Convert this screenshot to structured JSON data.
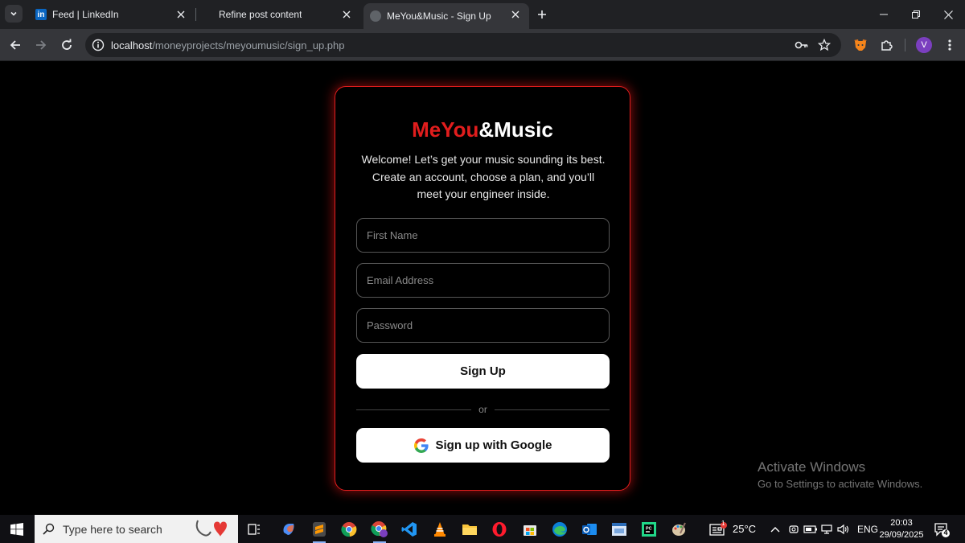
{
  "browser": {
    "tabs": [
      {
        "title": "Feed | LinkedIn",
        "favicon": "linkedin-icon",
        "active": false
      },
      {
        "title": "Refine post content",
        "favicon": "none",
        "active": false
      },
      {
        "title": "MeYou&Music - Sign Up",
        "favicon": "globe-icon",
        "active": true
      }
    ],
    "url_host": "localhost",
    "url_path": "/moneyprojects/meyoumusic/sign_up.php",
    "profile_initial": "V",
    "linkedin_glyph": "in"
  },
  "page": {
    "brand_red": "MeYou",
    "brand_white": "&Music",
    "welcome": "Welcome! Let’s get your music sounding its best. Create an account, choose a plan, and you’ll meet your engineer inside.",
    "first_name_placeholder": "First Name",
    "email_placeholder": "Email Address",
    "password_placeholder": "Password",
    "signup_label": "Sign Up",
    "divider_text": "or",
    "google_label": "Sign up with Google",
    "accent_color": "#e11d1d"
  },
  "watermark": {
    "line1": "Activate Windows",
    "line2": "Go to Settings to activate Windows."
  },
  "taskbar": {
    "search_placeholder": "Type here to search",
    "weather": "25°C",
    "weather_badge": "1",
    "language": "ENG",
    "time": "20:03",
    "date": "29/09/2025",
    "notification_count": "4"
  }
}
